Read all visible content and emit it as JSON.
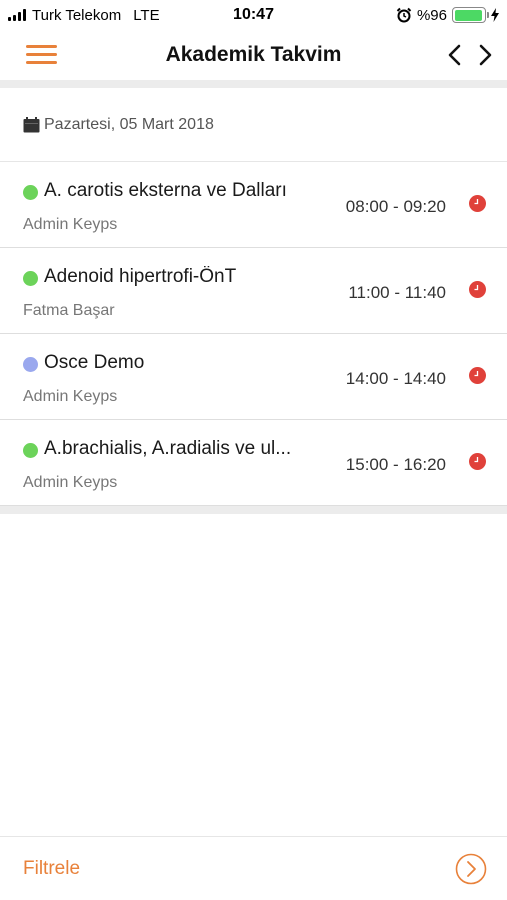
{
  "status_bar": {
    "carrier": "Turk Telekom",
    "network": "LTE",
    "time": "10:47",
    "battery_text": "%96",
    "battery_level": 0.96
  },
  "nav": {
    "title": "Akademik Takvim",
    "menu_icon": "hamburger-menu-icon",
    "prev_icon": "chevron-left-icon",
    "next_icon": "chevron-right-icon"
  },
  "date_header": {
    "icon": "calendar-icon",
    "label": "Pazartesi, 05 Mart 2018"
  },
  "events": [
    {
      "title": "A. carotis eksterna ve Dalları",
      "person": "Admin Keyps",
      "time": "08:00 - 09:20",
      "dot_color": "#6cd35a",
      "clock_icon": "clock-icon"
    },
    {
      "title": "Adenoid hipertrofi-ÖnT",
      "person": "Fatma Başar",
      "time": "11:00 - 11:40",
      "dot_color": "#6cd35a",
      "clock_icon": "clock-icon"
    },
    {
      "title": "Osce Demo",
      "person": "Admin Keyps",
      "time": "14:00 - 14:40",
      "dot_color": "#9aa8ee",
      "clock_icon": "clock-icon"
    },
    {
      "title": "A.brachialis, A.radialis ve ul...",
      "person": "Admin Keyps",
      "time": "15:00 - 16:20",
      "dot_color": "#6cd35a",
      "clock_icon": "clock-icon"
    }
  ],
  "footer": {
    "filter_label": "Filtrele",
    "go_icon": "circle-chevron-right-icon"
  },
  "colors": {
    "accent": "#e8813a",
    "clock_red": "#e0413a",
    "battery_green": "#4cd964"
  }
}
